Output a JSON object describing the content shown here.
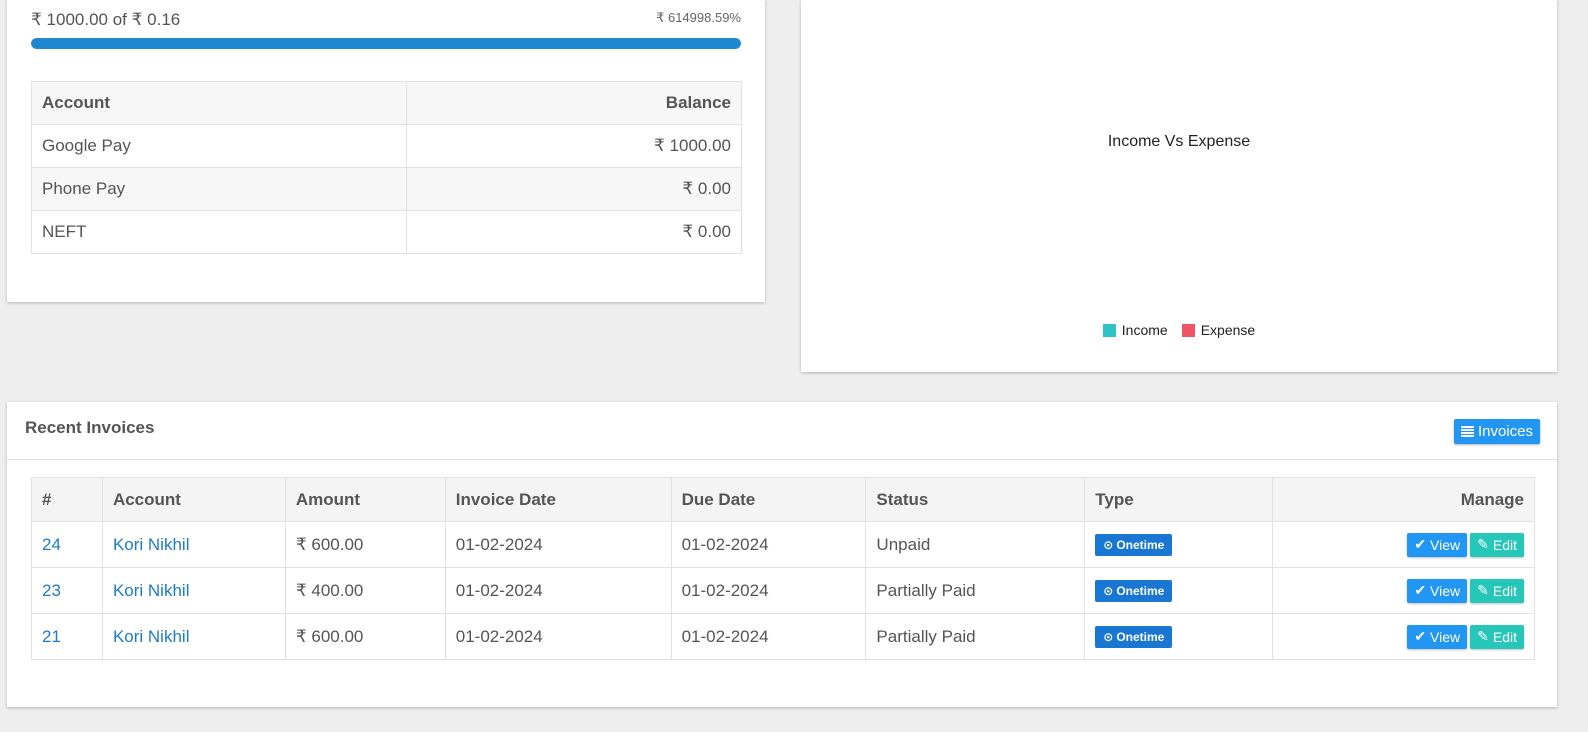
{
  "accounts_panel": {
    "progress_caption": "₹ 1000.00 of ₹ 0.16",
    "progress_percent_text": "₹ 614998.59%",
    "progress_fill_fraction": 1.0,
    "table": {
      "headers": [
        "Account",
        "Balance"
      ],
      "rows": [
        {
          "account": "Google Pay",
          "balance": "₹ 1000.00"
        },
        {
          "account": "Phone Pay",
          "balance": "₹ 0.00"
        },
        {
          "account": "NEFT",
          "balance": "₹ 0.00"
        }
      ]
    }
  },
  "chart_panel": {
    "chart_data": {
      "type": "pie",
      "title": "Income Vs Expense",
      "categories": [
        "Income",
        "Expense"
      ],
      "values": [],
      "legend_position": "bottom",
      "colors": [
        "#2ec4c6",
        "#ef5366"
      ]
    }
  },
  "invoices_panel": {
    "title": "Recent Invoices",
    "invoices_button_label": "Invoices",
    "headers": [
      "#",
      "Account",
      "Amount",
      "Invoice Date",
      "Due Date",
      "Status",
      "Type",
      "Manage"
    ],
    "rows": [
      {
        "id": "24",
        "account": "Kori Nikhil",
        "amount": "₹ 600.00",
        "invoice_date": "01-02-2024",
        "due_date": "01-02-2024",
        "status": "Unpaid",
        "type": "Onetime"
      },
      {
        "id": "23",
        "account": "Kori Nikhil",
        "amount": "₹ 400.00",
        "invoice_date": "01-02-2024",
        "due_date": "01-02-2024",
        "status": "Partially Paid",
        "type": "Onetime"
      },
      {
        "id": "21",
        "account": "Kori Nikhil",
        "amount": "₹ 600.00",
        "invoice_date": "01-02-2024",
        "due_date": "01-02-2024",
        "status": "Partially Paid",
        "type": "Onetime"
      }
    ],
    "view_label": "View",
    "edit_label": "Edit"
  },
  "colors": {
    "primary": "#2196f3",
    "teal": "#26c6b8",
    "badge": "#1976d2",
    "link": "#1e7bc6"
  }
}
